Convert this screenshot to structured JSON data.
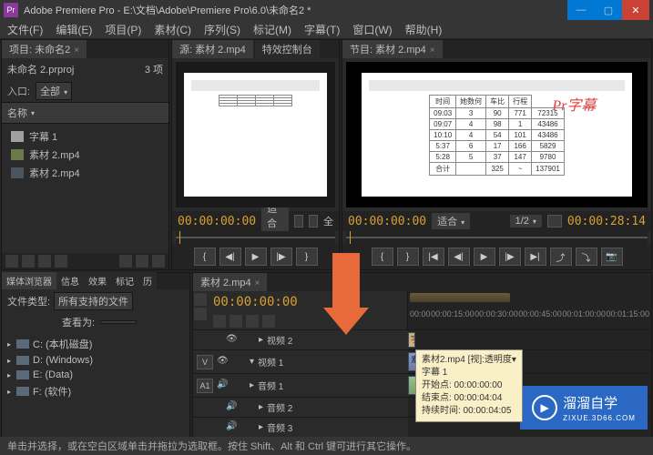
{
  "titlebar": {
    "app_icon": "Pr",
    "title": "Adobe Premiere Pro - E:\\文档\\Adobe\\Premiere Pro\\6.0\\未命名2 *"
  },
  "menu": [
    "文件(F)",
    "编辑(E)",
    "项目(P)",
    "素材(C)",
    "序列(S)",
    "标记(M)",
    "字幕(T)",
    "窗口(W)",
    "帮助(H)"
  ],
  "project": {
    "tab": "项目: 未命名2",
    "filename": "未命名 2.prproj",
    "item_count": "3 项",
    "input_label": "入口:",
    "input_value": "全部",
    "name_header": "名称",
    "items": [
      {
        "label": "字幕 1",
        "type": "title"
      },
      {
        "label": "素材 2.mp4",
        "type": "seq"
      },
      {
        "label": "素材 2.mp4",
        "type": "clip"
      }
    ]
  },
  "source_monitor": {
    "tab_source": "源: 素材 2.mp4",
    "tab_effects": "特效控制台",
    "timecode": "00:00:00:00",
    "fit": "适合",
    "full": "全"
  },
  "program_monitor": {
    "tab": "节目: 素材 2.mp4",
    "timecode_left": "00:00:00:00",
    "fit": "适合",
    "fraction": "1/2",
    "timecode_right": "00:00:28:14",
    "overlay_text": "Pr字幕",
    "sheet_rows": [
      [
        "时间",
        "她数何",
        "车比",
        "行程"
      ],
      [
        "09:03",
        "3",
        "90 ",
        "771",
        "72315"
      ],
      [
        "09:07",
        "4",
        "98",
        "1",
        "43486"
      ],
      [
        "10:10",
        "4",
        "54",
        "101",
        "43486"
      ],
      [
        "5:37",
        "6",
        "17",
        "166",
        "5829"
      ],
      [
        "5:28",
        "5",
        "37",
        "147",
        "9780"
      ],
      [
        "合计",
        "",
        "325",
        "~",
        "137901"
      ]
    ]
  },
  "media_browser": {
    "tabs": [
      "媒体浏览器",
      "信息",
      "效果",
      "标记",
      "历"
    ],
    "filetype_label": "文件类型:",
    "filetype_value": "所有支持的文件",
    "view_label": "查看为:",
    "drives": [
      "C: (本机磁盘)",
      "D: (Windows)",
      "E: (Data)",
      "F: (软件)"
    ]
  },
  "timeline": {
    "tab": "素材 2.mp4",
    "timecode": "00:00:00:00",
    "ruler": [
      "00:00",
      "00:00:15:00",
      "00:00:30:00",
      "00:00:45:00",
      "00:01:00:00",
      "00:01:15:00"
    ],
    "tracks": {
      "v2": "视频 2",
      "v1": "视频 1",
      "a1": "音频 1",
      "a2": "音频 2",
      "a3": "音频 3"
    },
    "v_label": "V",
    "a1_label": "A1",
    "clip_label": "素材2.mp4 [视]:透明度 ▾",
    "tooltip": {
      "line1": "素材2.mp4 [视]:透明度▾",
      "line2": "字幕 1",
      "line3": "开始点: 00:00:00:00",
      "line4": "结束点: 00:00:04:04",
      "line5": "持续时间: 00:00:04:05"
    }
  },
  "watermark": {
    "text": "溜溜自学",
    "sub": "ZIXUE.3D66.COM"
  },
  "statusbar": "单击并选择，或在空白区域单击并拖拉为选取框。按住 Shift、Alt 和 Ctrl 键可进行其它操作。"
}
